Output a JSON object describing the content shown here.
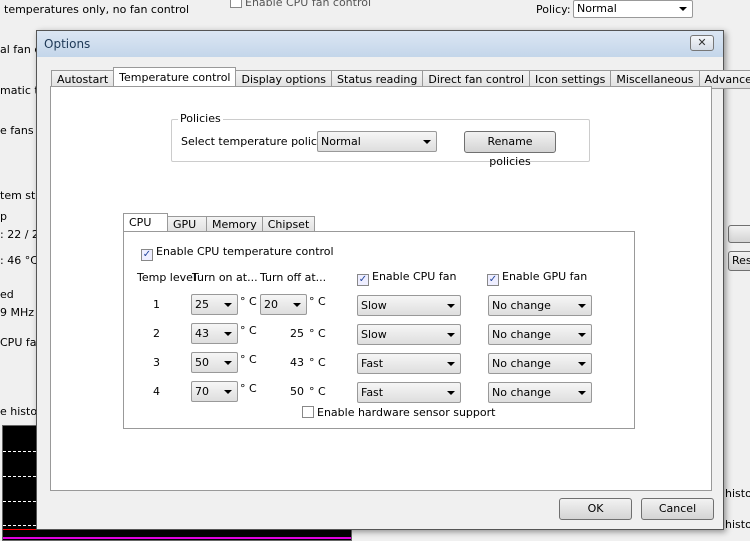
{
  "background": {
    "lines": [
      "temperatures only, no fan control",
      "al fan c",
      "matic te",
      "e fans to",
      "tem sta",
      "p",
      ": 22 / 2",
      ": 46 °C",
      "ed",
      "9 MHz",
      "CPU fa",
      "e histor"
    ],
    "enable_cpu_fan_control": "Enable CPU fan control",
    "policy_label": "Policy:",
    "policy_value": "Normal",
    "right_buttons": [
      "Res"
    ],
    "right_labels": [
      "histo",
      "histo"
    ]
  },
  "dialog": {
    "title": "Options",
    "close_icon": "close-icon",
    "tabs": [
      "Autostart",
      "Temperature control",
      "Display options",
      "Status reading",
      "Direct fan control",
      "Icon settings",
      "Miscellaneous",
      "Advanced"
    ],
    "active_tab": "Temperature control",
    "policies": {
      "group_label": "Policies",
      "select_label": "Select temperature policy:",
      "select_value": "Normal",
      "rename_button": "Rename policies"
    },
    "device_tabs": [
      "CPU",
      "GPU",
      "Memory",
      "Chipset"
    ],
    "active_device_tab": "CPU",
    "enable_cpu_temp_control": "Enable CPU temperature control",
    "headers": {
      "temp_level": "Temp level",
      "turn_on": "Turn on at...",
      "turn_off": "Turn off at...",
      "cpu_fan": "Enable CPU fan",
      "gpu_fan": "Enable GPU fan"
    },
    "unit": "° C",
    "rows": [
      {
        "level": "1",
        "on": "25",
        "off": "20",
        "off_is_select": true,
        "cpu": "Slow",
        "gpu": "No change"
      },
      {
        "level": "2",
        "on": "43",
        "off": "25",
        "off_is_select": false,
        "cpu": "Slow",
        "gpu": "No change"
      },
      {
        "level": "3",
        "on": "50",
        "off": "43",
        "off_is_select": false,
        "cpu": "Fast",
        "gpu": "No change"
      },
      {
        "level": "4",
        "on": "70",
        "off": "50",
        "off_is_select": false,
        "cpu": "Fast",
        "gpu": "No change"
      }
    ],
    "hardware_sensor": "Enable hardware sensor support",
    "ok": "OK",
    "cancel": "Cancel"
  }
}
